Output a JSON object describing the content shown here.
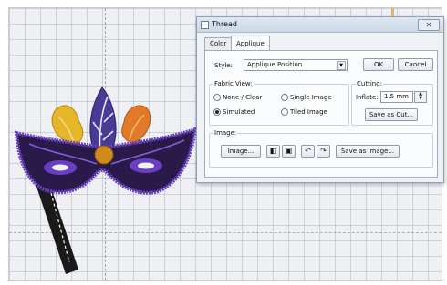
{
  "window": {
    "title": "Thread",
    "close_glyph": "✕"
  },
  "tabs": [
    {
      "label": "Color"
    },
    {
      "label": "Applique"
    }
  ],
  "style": {
    "label": "Style:",
    "value": "Applique Position"
  },
  "buttons": {
    "ok": "OK",
    "cancel": "Cancel",
    "save_as_cut": "Save as Cut...",
    "image": "Image...",
    "save_as_image": "Save as Image..."
  },
  "fabric_view": {
    "title": "Fabric View:",
    "options": [
      {
        "label": "None / Clear",
        "selected": false
      },
      {
        "label": "Single Image",
        "selected": false
      },
      {
        "label": "Simulated",
        "selected": true
      },
      {
        "label": "Tiled Image",
        "selected": false
      }
    ]
  },
  "cutting": {
    "title": "Cutting:",
    "inflate_label": "Inflate:",
    "inflate_value": "1.5 mm"
  },
  "image_group": {
    "title": "Image:",
    "tool_icons": [
      "fit-image-icon",
      "fill-image-icon",
      "undo-icon",
      "redo-icon"
    ],
    "tool_glyphs": [
      "◧",
      "▣",
      "↶",
      "↷"
    ]
  },
  "colors": {
    "mask_fill": "#2a1a4a",
    "mask_trim": "#6a3fc4",
    "feather_yellow": "#e5b52a",
    "feather_purple": "#4a3a96",
    "feather_orange": "#e07a28",
    "jewel": "#d08a1c",
    "stick": "#1a1a1a",
    "window_bg": "#eef2f6"
  }
}
